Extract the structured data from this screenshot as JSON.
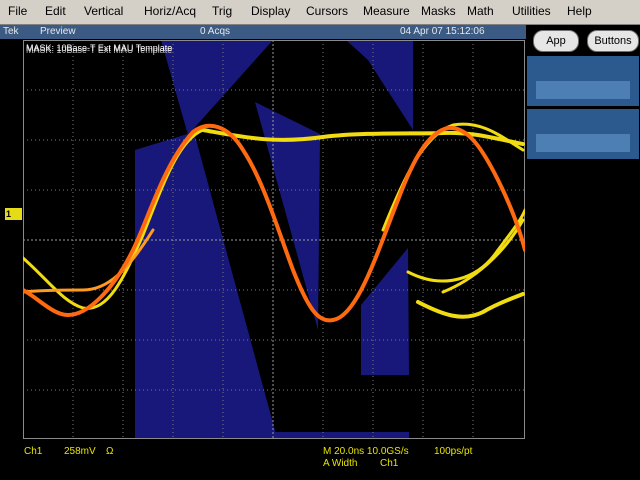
{
  "menubar": {
    "items": [
      "File",
      "Edit",
      "Vertical",
      "Horiz/Acq",
      "Trig",
      "Display",
      "Cursors",
      "Measure",
      "Masks",
      "Math",
      "Utilities",
      "Help"
    ]
  },
  "status": {
    "brand": "Tek",
    "mode": "Preview",
    "acqs": "0 Acqs",
    "datetime": "04 Apr 07 15:12:06"
  },
  "right_panel": {
    "app_button": "App",
    "buttons_button": "Buttons"
  },
  "display": {
    "mask_label": "MASK: 10Base-T Ext MAU Template",
    "channel_marker": "1"
  },
  "readout": {
    "channel": "Ch1",
    "volts_per_div": "258mV",
    "coupling": "Ω",
    "timebase": "M 20.0ns 10.0GS/s",
    "resolution": "100ps/pt",
    "trigger_mode": "A  Width",
    "trigger_source": "Ch1"
  },
  "colors": {
    "mask_fill": "#18187a",
    "trace_yellow": "#f0dc10",
    "trace_orange": "#ff7a1a",
    "grid": "#7a7a7a",
    "readout_text": "#e8e400",
    "status_bg": "#3b5b84"
  }
}
